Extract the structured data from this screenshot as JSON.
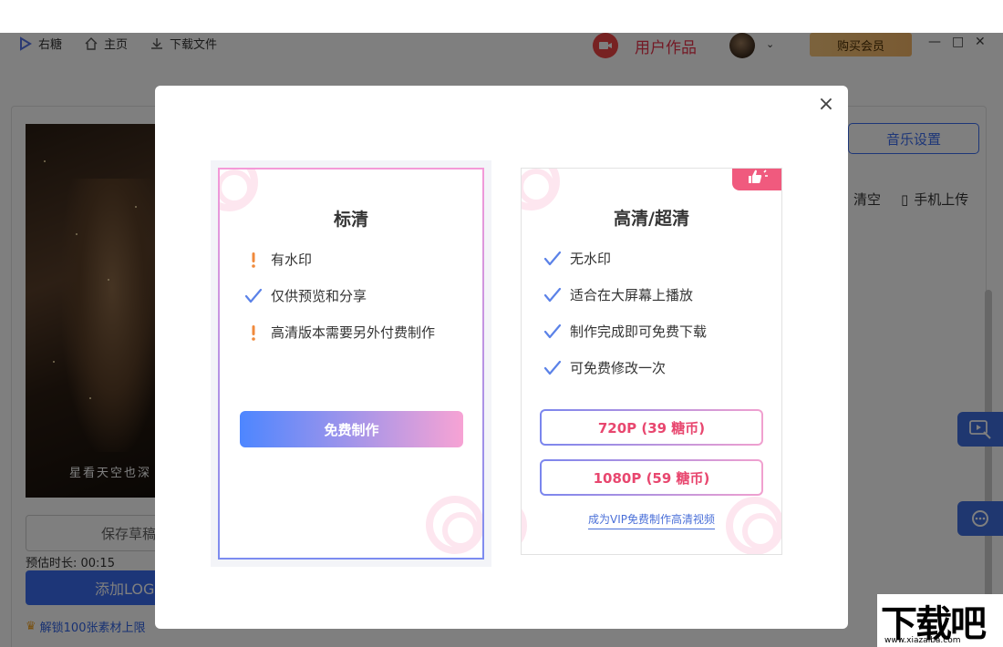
{
  "topbar": {
    "app_name": "右糖",
    "home_label": "主页",
    "download_label": "下载文件",
    "user_works_label": "用户作品",
    "buy_vip_label": "购买会员",
    "minimize": "—",
    "maximize": "□",
    "close": "✕"
  },
  "editor": {
    "preview_caption": "星看天空也深",
    "save_draft_label": "保存草稿",
    "estimated_duration": "预估时长: 00:15",
    "add_logo_label": "添加LOGO",
    "unlock_text": "解锁100张素材上限",
    "music_settings_label": "音乐设置",
    "clear_label": "清空",
    "phone_upload_label": "手机上传"
  },
  "dialog": {
    "close_symbol": "×",
    "standard": {
      "title": "标清",
      "features": [
        {
          "icon": "exclamation",
          "text": "有水印"
        },
        {
          "icon": "check",
          "text": "仅供预览和分享"
        },
        {
          "icon": "exclamation",
          "text": "高清版本需要另外付费制作"
        }
      ],
      "button_label": "免费制作"
    },
    "hd": {
      "title": "高清/超清",
      "features": [
        {
          "icon": "check",
          "text": "无水印"
        },
        {
          "icon": "check",
          "text": "适合在大屏幕上播放"
        },
        {
          "icon": "check",
          "text": "制作完成即可免费下载"
        },
        {
          "icon": "check",
          "text": "可免费修改一次"
        }
      ],
      "price_720_label": "720P (39 糖币)",
      "price_1080_label": "1080P (59 糖币)",
      "vip_link_label": "成为VIP免费制作高清视频"
    }
  },
  "watermark": {
    "main": "下载吧",
    "url": "www.xiazaiba.com"
  },
  "colors": {
    "primary_blue": "#3b6df0",
    "accent_pink": "#e8476f",
    "warning_orange": "#f08a3c",
    "check_blue": "#5b82e8",
    "vip_gold": "#f3b566"
  }
}
